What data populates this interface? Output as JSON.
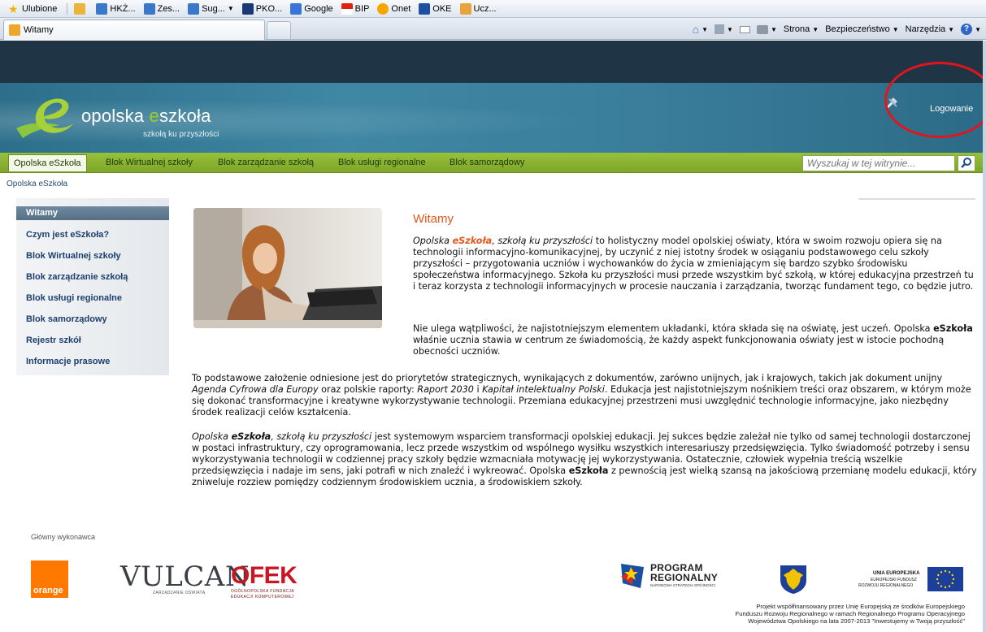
{
  "browser": {
    "favorites_label": "Ulubione",
    "favorites": [
      "HKŻ...",
      "Zes...",
      "Sug...",
      "PKO...",
      "Google",
      "BIP",
      "Onet",
      "OKE",
      "Ucz..."
    ],
    "tab_title": "Witamy",
    "commands": {
      "page": "Strona",
      "safety": "Bezpieczeństwo",
      "tools": "Narzędzia"
    }
  },
  "header": {
    "logo_prefix": "opolska ",
    "logo_e": "e",
    "logo_suffix": "szkoła",
    "tagline": "szkołą ku przyszłości",
    "login": "Logowanie"
  },
  "nav": {
    "items": [
      "Opolska eSzkoła",
      "Blok Wirtualnej szkoły",
      "Blok zarządzanie szkołą",
      "Blok usługi regionalne",
      "Blok samorządowy"
    ],
    "search_placeholder": "Wyszukaj w tej witrynie..."
  },
  "breadcrumb": "Opolska eSzkoła",
  "sidebar": {
    "items": [
      "Witamy",
      "Czym jest eSzkoła?",
      "Blok Wirtualnej szkoły",
      "Blok zarządzanie szkołą",
      "Blok usługi regionalne",
      "Blok samorządowy",
      "Rejestr szkół",
      "Informacje prasowe"
    ]
  },
  "content": {
    "title": "Witamy",
    "p1_a": "Opolska ",
    "p1_brand": "eSzkoła",
    "p1_b": ", szkołą ku przyszłości",
    "p1_c": " to holistyczny model opolskiej oświaty, która w swoim rozwoju opiera się na technologii informacyjno-komunikacyjnej, by uczynić z niej istotny środek w osiąganiu podstawowego celu szkoły przyszłości – przygotowania uczniów i wychowanków do życia w zmieniającym się bardzo szybko środowisku społeczeństwa informacyjnego. Szkoła ku przyszłości musi przede wszystkim być szkołą, w której edukacyjna przestrzeń tu i teraz korzysta z technologii informacyjnych w procesie nauczania i zarządzania, tworząc fundament tego, co będzie jutro.",
    "p2_a": "Nie ulega wątpliwości, że najistotniejszym elementem układanki, która składa się na oświatę, jest uczeń. Opolska ",
    "p2_brand": "eSzkoła",
    "p2_b": " właśnie ucznia stawia w centrum ze świadomością, że każdy aspekt funkcjonowania oświaty jest w istocie pochodną obecności uczniów.",
    "p3_a": "To podstawowe założenie odniesione jest do priorytetów strategicznych, wynikających z dokumentów, zarówno unijnych, jak i krajowych, takich jak dokument unijny ",
    "p3_i1": "Agenda Cyfrowa dla Europy",
    "p3_b": " oraz polskie raporty: ",
    "p3_i2": "Raport 2030",
    "p3_c": " i ",
    "p3_i3": "Kapitał intelektualny Polski",
    "p3_d": ". Edukacja jest najistotniejszym nośnikiem treści oraz obszarem, w którym może się dokonać transformacyjne i kreatywne wykorzystywanie technologii. Przemiana edukacyjnej przestrzeni musi uwzględnić technologie informacyjne, jako niezbędny środek realizacji celów kształcenia.",
    "p4_i1": "Opolska ",
    "p4_brand": "eSzkoła",
    "p4_i2": ", szkołą ku przyszłości",
    "p4_a": " jest systemowym wsparciem transformacji opolskiej edukacji. Jej sukces będzie zależał nie tylko od samej technologii dostarczonej w postaci infrastruktury, czy oprogramowania, lecz przede wszystkim od wspólnego wysiłku wszystkich interesariuszy przedsięwzięcia. Tylko świadomość potrzeby i sensu wykorzystywania technologii w codziennej pracy szkoły będzie wzmacniała motywację jej wykorzystywania. Ostatecznie, człowiek wypełnia treścią wszelkie przedsięwzięcia i nadaje im sens, jaki potrafi w nich znaleźć i wykreować. Opolska ",
    "p4_brand2": "eSzkoła",
    "p4_b": " z pewnością jest wielką szansą na jakościową przemianę modelu edukacji, który zniweluje rozziew pomiędzy codziennym środowiskiem ucznia, a środowiskiem szkoły."
  },
  "footer": {
    "label": "Główny wykonawca",
    "orange": "orange",
    "vulcan": "VULCAN",
    "vulcan_sub": "ZARZĄDZANIE OŚWIATĄ",
    "ofek": "OFEK",
    "ofek_sub1": "OGÓLNOPOLSKA FUNDACJA",
    "ofek_sub2": "EDUKACJI KOMPUTEROWEJ",
    "program_1": "PROGRAM",
    "program_2": "REGIONALNY",
    "program_3": "NARODOWA STRATEGIA SPÓJNOŚCI",
    "eu_1": "UNIA EUROPEJSKA",
    "eu_2": "EUROPEJSKI FUNDUSZ",
    "eu_3": "ROZWOJU REGIONALNEGO",
    "project_lines": [
      "Projekt współfinansowany przez Unię Europejską ze środków Europejskiego",
      "Funduszu Rozwoju Regionalnego w ramach Regionalnego Programu Operacyjnego",
      "Województwa Opolskiego na lata 2007-2013 \"Inwestujemy w Twoją przyszłość\""
    ]
  },
  "colors": {
    "accent_orange": "#e4571e",
    "nav_green": "#8cb535",
    "banner_teal": "#3a7e9b",
    "header_dark": "#1f3445",
    "annotation_red": "#e0161c"
  }
}
